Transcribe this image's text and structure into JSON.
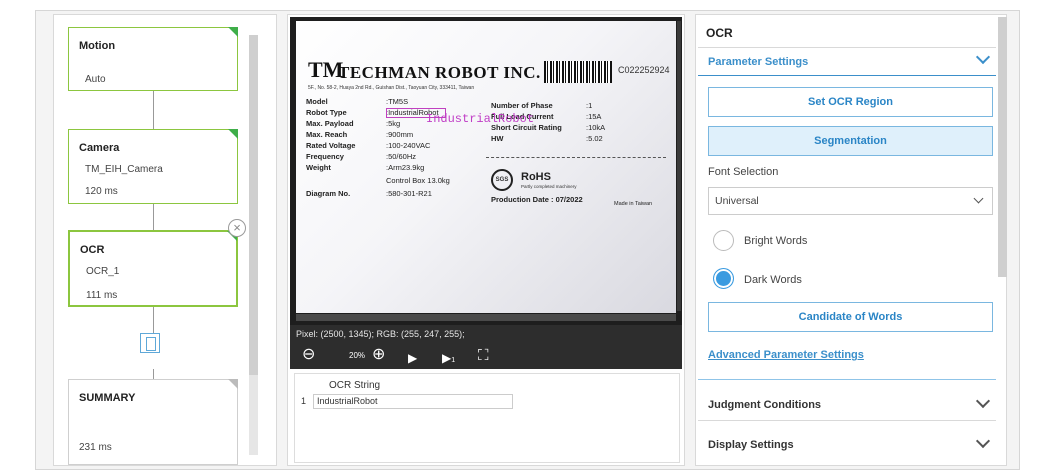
{
  "flow": {
    "nodes": [
      {
        "title": "Motion",
        "lines": [
          "Auto"
        ]
      },
      {
        "title": "Camera",
        "lines": [
          "TM_EIH_Camera",
          "120 ms"
        ]
      },
      {
        "title": "OCR",
        "lines": [
          "OCR_1",
          "111 ms"
        ]
      },
      {
        "title": "SUMMARY",
        "lines": [
          "231 ms"
        ]
      }
    ]
  },
  "viewer": {
    "label": {
      "logo": "TM",
      "company": "TECHMAN ROBOT INC.",
      "address": "5F., No. 58-2, Huaya 2nd Rd., Guishan Dist., Taoyuan City, 333411, Taiwan",
      "serial": "C022252924",
      "specs_left": [
        {
          "k": "Model",
          "v": ":TM5S"
        },
        {
          "k": "Robot Type",
          "v": ":IndustrialRobot"
        },
        {
          "k": "Max. Payload",
          "v": ":5kg"
        },
        {
          "k": "Max. Reach",
          "v": ":900mm"
        },
        {
          "k": "Rated Voltage",
          "v": ":100-240VAC"
        },
        {
          "k": "Frequency",
          "v": ":50/60Hz"
        },
        {
          "k": "Weight",
          "v": ":Arm23.9kg"
        },
        {
          "k": "",
          "v": "Control Box 13.0kg"
        },
        {
          "k": "Diagram No.",
          "v": ":580-301-R21"
        }
      ],
      "specs_right": [
        {
          "k": "Number of Phase",
          "v": ":1"
        },
        {
          "k": "Full Load Current",
          "v": ":15A"
        },
        {
          "k": "Short Circuit Rating",
          "v": ":10kA"
        },
        {
          "k": "HW",
          "v": ":5.02"
        }
      ],
      "sgs": "SGS",
      "rohs": "RoHS",
      "rohs_sub": "Partly completed machinery",
      "production_date": "Production Date : 07/2022",
      "made_in": "Made in Taiwan"
    },
    "ocr_overlay": "IndustrialRobot",
    "pixel_info": "Pixel: (2500, 1345); RGB: (255, 247, 255);",
    "zoom": "20%",
    "table": {
      "header": "OCR String",
      "rows": [
        {
          "num": "1",
          "value": "IndustrialRobot"
        }
      ]
    }
  },
  "settings": {
    "title": "OCR",
    "parameter_settings": "Parameter Settings",
    "set_ocr_region": "Set OCR Region",
    "segmentation": "Segmentation",
    "font_selection_label": "Font Selection",
    "font_selection_value": "Universal",
    "bright_words": "Bright Words",
    "dark_words": "Dark Words",
    "candidate_of_words": "Candidate of Words",
    "advanced_parameter_settings": "Advanced Parameter Settings",
    "judgment_conditions": "Judgment Conditions",
    "display_settings": "Display Settings",
    "selected_polarity": "dark"
  },
  "colors": {
    "accent": "#3b8fca",
    "node_border": "#8cc63f",
    "node_corner": "#3fae49"
  }
}
